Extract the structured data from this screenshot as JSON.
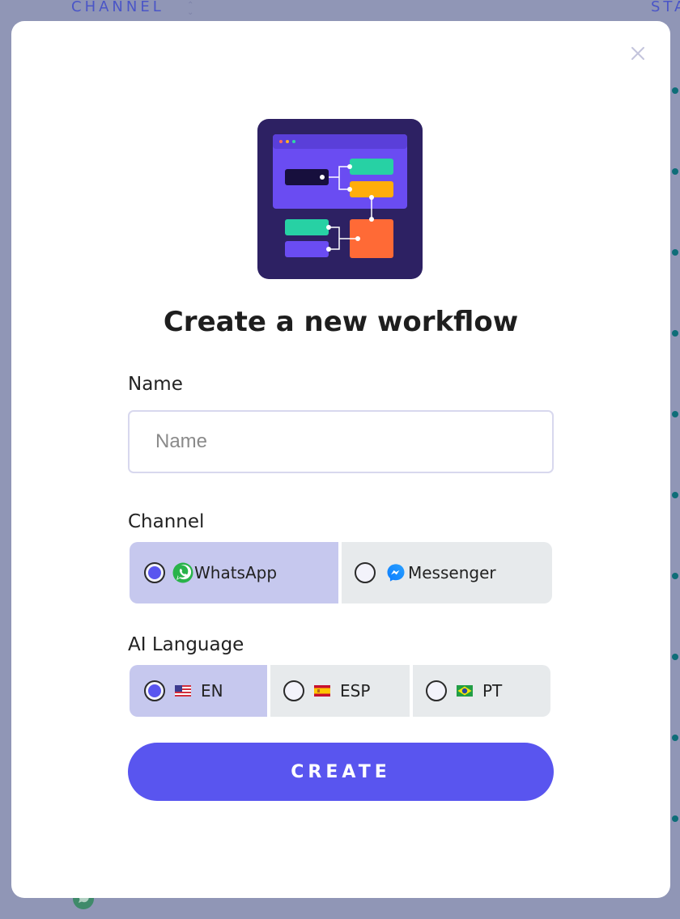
{
  "background": {
    "columns": {
      "channel": "CHANNEL",
      "status": "STA"
    }
  },
  "modal": {
    "close_glyph": "×",
    "title": "Create a new workflow",
    "name_field": {
      "label": "Name",
      "placeholder": "Name",
      "value": ""
    },
    "channel": {
      "label": "Channel",
      "options": [
        {
          "label": "WhatsApp",
          "icon": "whatsapp-icon",
          "selected": true
        },
        {
          "label": "Messenger",
          "icon": "messenger-icon",
          "selected": false
        }
      ]
    },
    "ai_language": {
      "label": "AI Language",
      "options": [
        {
          "label": "EN",
          "icon": "us-flag-icon",
          "selected": true
        },
        {
          "label": "ESP",
          "icon": "spain-flag-icon",
          "selected": false
        },
        {
          "label": "PT",
          "icon": "brazil-flag-icon",
          "selected": false
        }
      ]
    },
    "create_button": "CREATE"
  },
  "colors": {
    "accent": "#5955ef",
    "selected_option": "#c6c8ee",
    "unselected_option": "#e7eaec",
    "overlay": "#9096b6",
    "illustration_bg": "#2d2163"
  }
}
